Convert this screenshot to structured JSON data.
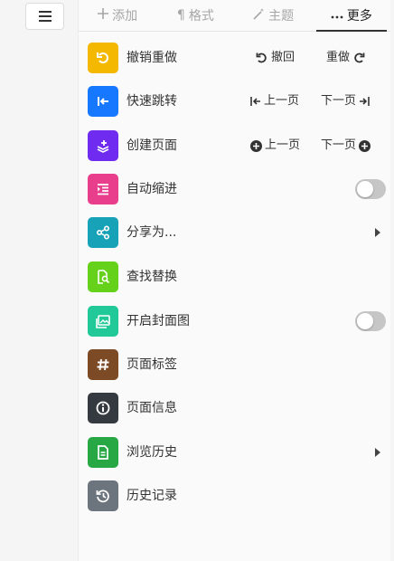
{
  "tabs": [
    {
      "label": "添加",
      "icon": "plus-icon",
      "active": false
    },
    {
      "label": "格式",
      "icon": "pilcrow-icon",
      "active": false
    },
    {
      "label": "主题",
      "icon": "magic-wand-icon",
      "active": false
    },
    {
      "label": "更多",
      "icon": "more-dots-icon",
      "active": true
    }
  ],
  "items": [
    {
      "label": "撤销重做",
      "color": "#f5b800",
      "icon": "undo-icon",
      "actions": [
        "撤回",
        "重做"
      ]
    },
    {
      "label": "快速跳转",
      "color": "#1677ff",
      "icon": "jump-to-icon",
      "actions": [
        "上一页",
        "下一页"
      ]
    },
    {
      "label": "创建页面",
      "color": "#6f2cf0",
      "icon": "create-page-icon",
      "actions": [
        "上一页",
        "下一页"
      ]
    },
    {
      "label": "自动缩进",
      "color": "#e83e8c",
      "icon": "indent-icon",
      "toggle": false
    },
    {
      "label": "分享为...",
      "color": "#17a2b8",
      "icon": "share-icon",
      "submenu": true
    },
    {
      "label": "查找替换",
      "color": "#66d11a",
      "icon": "find-replace-icon"
    },
    {
      "label": "开启封面图",
      "color": "#20c997",
      "icon": "cover-image-icon",
      "toggle": false
    },
    {
      "label": "页面标签",
      "color": "#7c4a24",
      "icon": "hashtag-icon"
    },
    {
      "label": "页面信息",
      "color": "#343a40",
      "icon": "info-icon"
    },
    {
      "label": "浏览历史",
      "color": "#28a745",
      "icon": "document-icon",
      "submenu": true
    },
    {
      "label": "历史记录",
      "color": "#6c757d",
      "icon": "history-icon"
    }
  ]
}
